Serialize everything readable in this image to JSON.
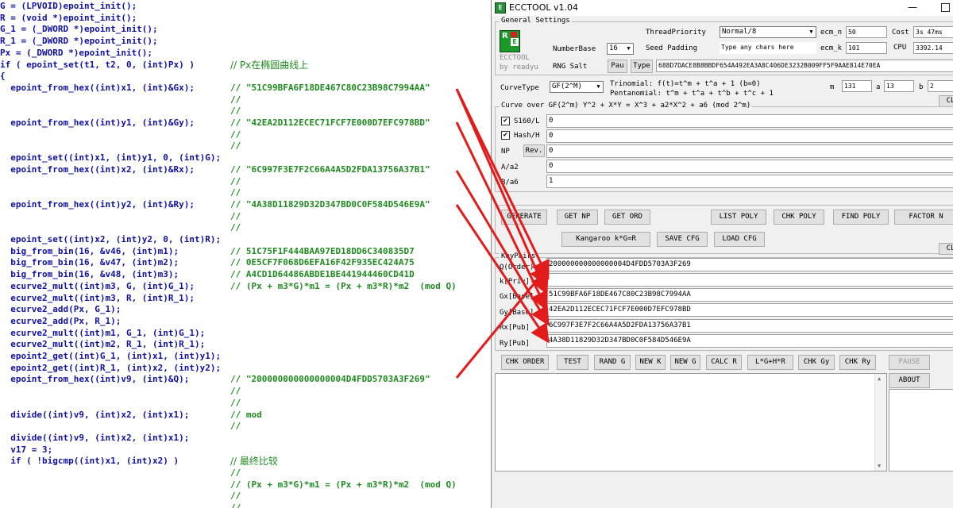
{
  "code_lines": [
    {
      "text": "G = (LPVOID)epoint_init();",
      "comment": ""
    },
    {
      "text": "R = (void *)epoint_init();",
      "comment": ""
    },
    {
      "text": "G_1 = (_DWORD *)epoint_init();",
      "comment": ""
    },
    {
      "text": "R_1 = (_DWORD *)epoint_init();",
      "comment": ""
    },
    {
      "text": "Px = (_DWORD *)epoint_init();",
      "comment": ""
    },
    {
      "text": "if ( epoint_set(t1, t2, 0, (int)Px) )",
      "comment": "// Px在椭圆曲线上"
    },
    {
      "text": "{",
      "comment": ""
    },
    {
      "text": "  epoint_from_hex((int)x1, (int)&Gx);",
      "comment": "// \"51C99BFA6F18DE467C80C23B98C7994AA\""
    },
    {
      "text": "",
      "comment": "//"
    },
    {
      "text": "",
      "comment": "//"
    },
    {
      "text": "  epoint_from_hex((int)y1, (int)&Gy);",
      "comment": "// \"42EA2D112ECEC71FCF7E000D7EFC978BD\""
    },
    {
      "text": "",
      "comment": "//"
    },
    {
      "text": "",
      "comment": "//"
    },
    {
      "text": "  epoint_set((int)x1, (int)y1, 0, (int)G);",
      "comment": ""
    },
    {
      "text": "  epoint_from_hex((int)x2, (int)&Rx);",
      "comment": "// \"6C997F3E7F2C66A4A5D2FDA13756A37B1\""
    },
    {
      "text": "",
      "comment": "//"
    },
    {
      "text": "",
      "comment": "//"
    },
    {
      "text": "  epoint_from_hex((int)y2, (int)&Ry);",
      "comment": "// \"4A38D11829D32D347BD0C0F584D546E9A\""
    },
    {
      "text": "",
      "comment": "//"
    },
    {
      "text": "",
      "comment": "//"
    },
    {
      "text": "  epoint_set((int)x2, (int)y2, 0, (int)R);",
      "comment": ""
    },
    {
      "text": "  big_from_bin(16, &v46, (int)m1);",
      "comment": "// 51C75F1F444BAA97ED18DD6C340835D7"
    },
    {
      "text": "  big_from_bin(16, &v47, (int)m2);",
      "comment": "// 0E5CF7F068D6EFA16F42F935EC424A75"
    },
    {
      "text": "  big_from_bin(16, &v48, (int)m3);",
      "comment": "// A4CD1D64486ABDE1BE441944460CD41D"
    },
    {
      "text": "  ecurve2_mult((int)m3, G, (int)G_1);",
      "comment": "// (Px + m3*G)*m1 = (Px + m3*R)*m2  (mod Q)"
    },
    {
      "text": "  ecurve2_mult((int)m3, R, (int)R_1);",
      "comment": ""
    },
    {
      "text": "  ecurve2_add(Px, G_1);",
      "comment": ""
    },
    {
      "text": "  ecurve2_add(Px, R_1);",
      "comment": ""
    },
    {
      "text": "  ecurve2_mult((int)m1, G_1, (int)G_1);",
      "comment": ""
    },
    {
      "text": "  ecurve2_mult((int)m2, R_1, (int)R_1);",
      "comment": ""
    },
    {
      "text": "  epoint2_get((int)G_1, (int)x1, (int)y1);",
      "comment": ""
    },
    {
      "text": "  epoint2_get((int)R_1, (int)x2, (int)y2);",
      "comment": ""
    },
    {
      "text": "  epoint_from_hex((int)v9, (int)&Q);",
      "comment": "// \"200000000000000004D4FDD5703A3F269\""
    },
    {
      "text": "",
      "comment": "//"
    },
    {
      "text": "",
      "comment": "//"
    },
    {
      "text": "  divide((int)v9, (int)x2, (int)x1);",
      "comment": "// mod"
    },
    {
      "text": "",
      "comment": "//"
    },
    {
      "text": "  divide((int)v9, (int)x2, (int)x1);",
      "comment": ""
    },
    {
      "text": "  v17 = 3;",
      "comment": ""
    },
    {
      "text": "  if ( !bigcmp((int)x1, (int)x2) )",
      "comment": "// 最终比较"
    },
    {
      "text": "",
      "comment": "//"
    },
    {
      "text": "",
      "comment": "// (Px + m3*G)*m1 = (Px + m3*R)*m2  (mod Q)"
    },
    {
      "text": "",
      "comment": "//"
    },
    {
      "text": "",
      "comment": "//"
    }
  ],
  "window": {
    "title": "ECCTOOL v1.04",
    "minimize": "—"
  },
  "general": {
    "group_label": "General Settings",
    "logo_text": "ECCTOOL",
    "by_text": "by readyu",
    "thread_priority_label": "ThreadPriority",
    "thread_priority_value": "Normal/8",
    "ecm_n_label": "ecm_n",
    "ecm_n_value": "50",
    "cost_label": "Cost",
    "cost_value": "3s 47ms",
    "number_base_label": "NumberBase",
    "number_base_value": "16",
    "seed_padding_label": "Seed Padding",
    "seed_padding_value": "Type any chars here",
    "ecm_k_label": "ecm_k",
    "ecm_k_value": "101",
    "cpu_label": "CPU",
    "cpu_value": "3392.14",
    "rng_salt_label": "RNG Salt",
    "pau_btn": "Pau",
    "type_btn": "Type",
    "salt_value": "688D7DACE8B8BBDF654A492EA3A8C406DE3232B009FF5F9AAE814E70EA"
  },
  "curve": {
    "curve_type_label": "CurveType",
    "curve_type_value": "GF(2^M)",
    "trinomial": "Trinomial:   f(t)=t^m + t^a + 1 (b=0)",
    "pentanomial": "Pentanomial: t^m + t^a + t^b + t^c + 1",
    "m_label": "m",
    "m_value": "131",
    "a_label": "a",
    "a_value": "13",
    "b_label": "b",
    "b_value": "2",
    "clr_btn": "CL",
    "group_label": "Curve over GF(2^m) Y^2 + X*Y = X^3 + a2*X^2 + a6 (mod 2^m)",
    "s160_label": "S160/L",
    "s160_value": "0",
    "hash_label": "Hash/H",
    "hash_value": "0",
    "np_label": "NP",
    "rev_btn": "Rev.",
    "np_value": "0",
    "a2_label": "A/a2",
    "a2_value": "0",
    "a6_label": "B/a6",
    "a6_value": "1"
  },
  "buttons_row1": [
    "GENERATE",
    "GET NP",
    "GET ORD",
    "LIST POLY",
    "CHK POLY",
    "FIND POLY",
    "FACTOR N"
  ],
  "buttons_row2": [
    "Kangaroo k*G=R",
    "SAVE CFG",
    "LOAD CFG"
  ],
  "clr2_btn": "CL",
  "keypairs": {
    "group_label": "KeyPairs",
    "rows": [
      {
        "label": "Q(Order)",
        "value": "200000000000000004D4FDD5703A3F269"
      },
      {
        "label": "k[Priv]",
        "value": ""
      },
      {
        "label": "Gx[Base]",
        "value": "51C99BFA6F18DE467C80C23B98C7994AA"
      },
      {
        "label": "Gy[Base]",
        "value": "42EA2D112ECEC71FCF7E000D7EFC978BD"
      },
      {
        "label": "Rx[Pub]",
        "value": "6C997F3E7F2C66A4A5D2FDA13756A37B1"
      },
      {
        "label": "Ry[Pub]",
        "value": "4A38D11829D32D347BD0C0F584D546E9A"
      }
    ]
  },
  "buttons_row3": [
    "CHK ORDER",
    "TEST",
    "RAND G",
    "NEW K",
    "NEW G",
    "CALC R",
    "L*G+H*R",
    "CHK Gy",
    "CHK Ry"
  ],
  "pause_btn": "PAUSE",
  "about_btn": "ABOUT",
  "colors": {
    "code": "#1010a0",
    "comment": "#1f8a1f",
    "arrow": "#e21b1b"
  }
}
